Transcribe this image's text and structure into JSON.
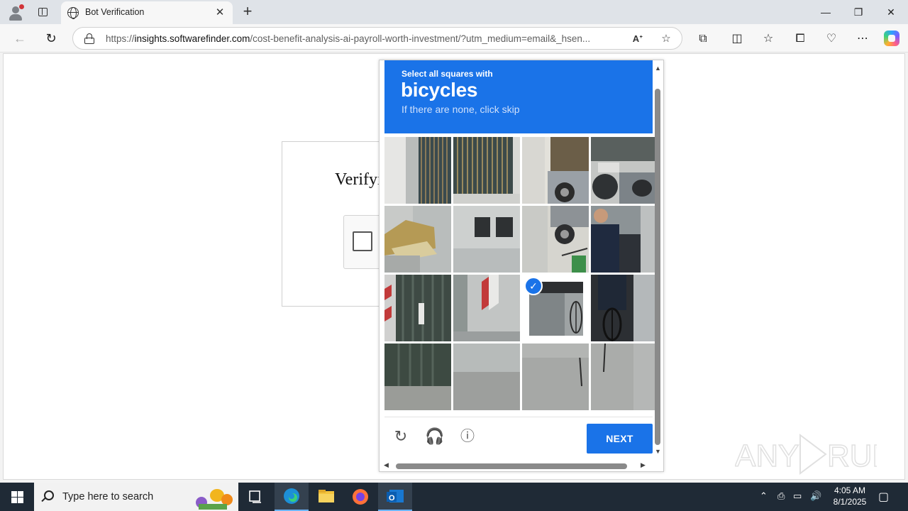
{
  "browser": {
    "tab_title": "Bot Verification",
    "tab_close": "✕",
    "new_tab": "+",
    "url_scheme": "https://",
    "url_host": "insights.softwarefinder.com",
    "url_path": "/cost-benefit-analysis-ai-payroll-worth-investment/?utm_medium=email&_hsen...",
    "window_controls": {
      "minimize": "—",
      "maximize": "❐",
      "close": "✕"
    }
  },
  "page": {
    "verify_title": "Verifying you are human"
  },
  "captcha": {
    "instruction": "Select all squares with",
    "target": "bicycles",
    "subtext": "If there are none, click skip",
    "next_label": "NEXT",
    "selected_tiles": [
      10
    ],
    "accent_color": "#1a73e8"
  },
  "taskbar": {
    "search_placeholder": "Type here to search",
    "time": "4:05 AM",
    "date": "8/1/2025"
  },
  "watermark": "ANY RUN"
}
